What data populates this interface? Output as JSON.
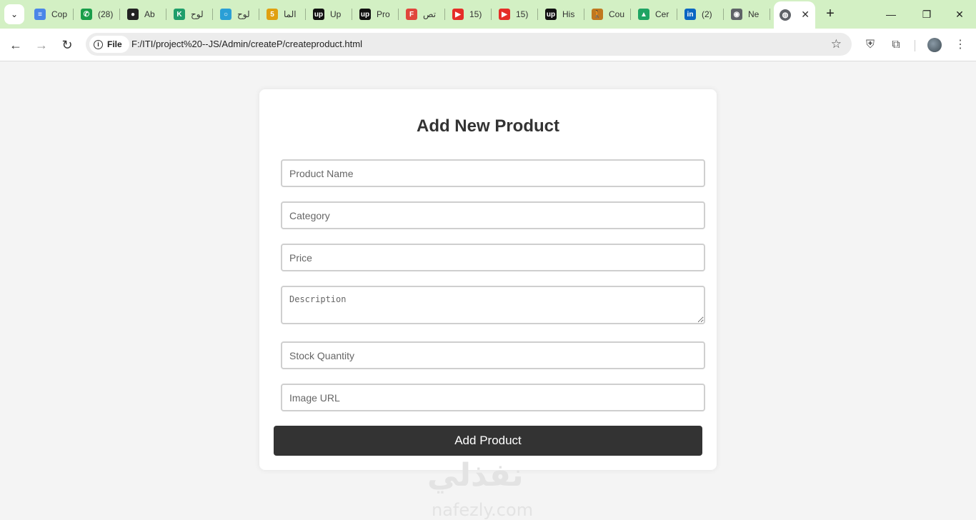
{
  "browser": {
    "tabs": [
      {
        "title": "Cop",
        "favicon": "docs-icon",
        "color": "#4a86e8",
        "glyph": "≡"
      },
      {
        "title": "(28)",
        "favicon": "whatsapp-icon",
        "color": "#1a9e4a",
        "glyph": "✆"
      },
      {
        "title": "Ab",
        "favicon": "github-icon",
        "color": "#222222",
        "glyph": "●"
      },
      {
        "title": "لوح",
        "favicon": "app-icon",
        "color": "#1e9e6a",
        "glyph": "K"
      },
      {
        "title": "لوح",
        "favicon": "circle-icon",
        "color": "#2a9fd6",
        "glyph": "○"
      },
      {
        "title": "الما",
        "favicon": "number-five-icon",
        "color": "#e0a010",
        "glyph": "5"
      },
      {
        "title": "Up",
        "favicon": "upwork-icon",
        "color": "#111111",
        "glyph": "up"
      },
      {
        "title": "Pro",
        "favicon": "upwork-icon",
        "color": "#111111",
        "glyph": "up"
      },
      {
        "title": "تص",
        "favicon": "figma-icon",
        "color": "#e0463c",
        "glyph": "F"
      },
      {
        "title": "15)",
        "favicon": "youtube-icon",
        "color": "#e52d27",
        "glyph": "▶"
      },
      {
        "title": "15)",
        "favicon": "youtube-icon",
        "color": "#e52d27",
        "glyph": "▶"
      },
      {
        "title": "His",
        "favicon": "upwork-icon",
        "color": "#111111",
        "glyph": "up"
      },
      {
        "title": "Cou",
        "favicon": "person-icon",
        "color": "#c07820",
        "glyph": "🚶"
      },
      {
        "title": "Cer",
        "favicon": "drive-icon",
        "color": "#1fa463",
        "glyph": "▲"
      },
      {
        "title": "(2)",
        "favicon": "linkedin-icon",
        "color": "#0a66c2",
        "glyph": "in"
      },
      {
        "title": "Ne",
        "favicon": "chrome-icon",
        "color": "#5f6368",
        "glyph": "◉"
      }
    ],
    "active_tab": {
      "favicon": "globe-icon",
      "close": "✕"
    },
    "new_tab": "+",
    "window_controls": {
      "minimize": "—",
      "restore": "❐",
      "close": "✕"
    },
    "nav": {
      "back": "←",
      "forward": "→",
      "reload": "↻"
    },
    "address": {
      "chip_label": "File",
      "url": "F:/ITI/project%20--JS/Admin/createP/createproduct.html",
      "bookmark_star": "☆"
    },
    "toolbar_icons": {
      "shield": "⛨",
      "extensions": "⧉",
      "menu": "⋮"
    }
  },
  "form": {
    "title": "Add New Product",
    "fields": {
      "name": "Product Name",
      "category": "Category",
      "price": "Price",
      "description": "Description",
      "stock": "Stock Quantity",
      "image": "Image URL"
    },
    "submit_label": "Add Product"
  },
  "watermark": {
    "arabic": "نفذلي",
    "latin": "nafezly.com"
  }
}
